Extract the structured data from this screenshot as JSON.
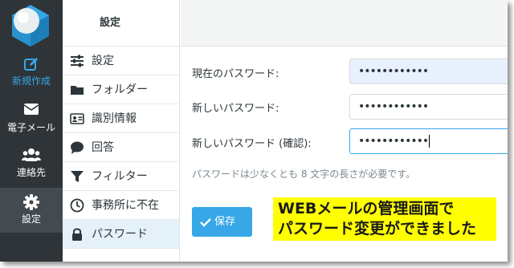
{
  "taskbar": {
    "items": [
      {
        "label": "新規作成",
        "icon": "pencil-square-icon"
      },
      {
        "label": "電子メール",
        "icon": "envelope-icon"
      },
      {
        "label": "連絡先",
        "icon": "users-icon"
      },
      {
        "label": "設定",
        "icon": "gear-icon"
      }
    ]
  },
  "menu": {
    "header": "設定",
    "items": [
      {
        "label": "設定",
        "icon": "sliders-icon"
      },
      {
        "label": "フォルダー",
        "icon": "folder-icon"
      },
      {
        "label": "識別情報",
        "icon": "id-card-icon"
      },
      {
        "label": "回答",
        "icon": "speech-bubble-icon"
      },
      {
        "label": "フィルター",
        "icon": "filter-icon"
      },
      {
        "label": "事務所に不在",
        "icon": "clock-icon"
      },
      {
        "label": "パスワード",
        "icon": "lock-icon"
      }
    ],
    "selected_index": 6
  },
  "form": {
    "current_label": "現在のパスワード:",
    "current_value": "••••••••••••",
    "new_label": "新しいパスワード:",
    "new_value": "••••••••••••",
    "confirm_label": "新しいパスワード (確認):",
    "confirm_value": "••••••••••••",
    "hint": "パスワードは少なくとも 8 文字の長さが必要です。",
    "save_label": "保存"
  },
  "annotation": {
    "line1": "WEBメールの管理画面で",
    "line2": "パスワード変更ができました"
  },
  "colors": {
    "accent": "#37a7e8",
    "taskbar": "#2e3438",
    "selected": "#e4f1f9",
    "note": "#ffff00"
  }
}
